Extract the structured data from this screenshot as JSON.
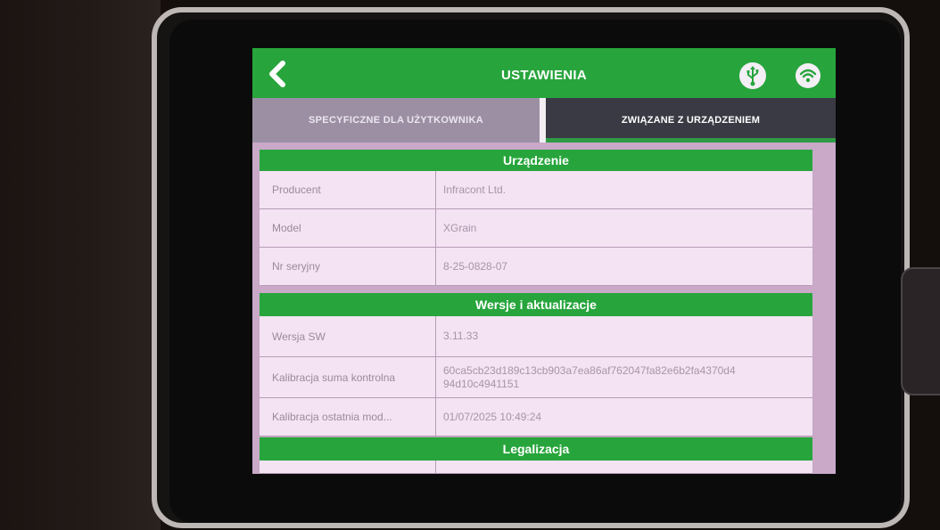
{
  "header": {
    "title": "USTAWIENIA",
    "back_icon": "chevron-left-icon",
    "usb_icon": "usb-icon",
    "wifi_icon": "wifi-icon"
  },
  "tabs": [
    {
      "label": "SPECYFICZNE DLA UŻYTKOWNIKA",
      "active": false
    },
    {
      "label": "ZWIĄZANE Z URZĄDZENIEM",
      "active": true
    }
  ],
  "sections": {
    "device": {
      "title": "Urządzenie",
      "rows": [
        {
          "label": "Producent",
          "value": "Infracont Ltd."
        },
        {
          "label": "Model",
          "value": "XGrain"
        },
        {
          "label": "Nr seryjny",
          "value": "8-25-0828-07"
        }
      ]
    },
    "versions": {
      "title": "Wersje i aktualizacje",
      "rows": [
        {
          "label": "Wersja SW",
          "value": "3.11.33"
        },
        {
          "label": "Kalibracja suma kontrolna",
          "value": "60ca5cb23d189c13cb903a7ea86af762047fa82e6b2fa4370d494d10c4941151"
        },
        {
          "label": "Kalibracja ostatnia mod...",
          "value": "01/07/2025 10:49:24"
        }
      ]
    },
    "legalization": {
      "title": "Legalizacja"
    }
  },
  "colors": {
    "accent_green": "#27a53c",
    "tab_active": "#3a3a44",
    "tab_inactive": "#9c8fa4",
    "row_bg": "#f3e3f3"
  }
}
